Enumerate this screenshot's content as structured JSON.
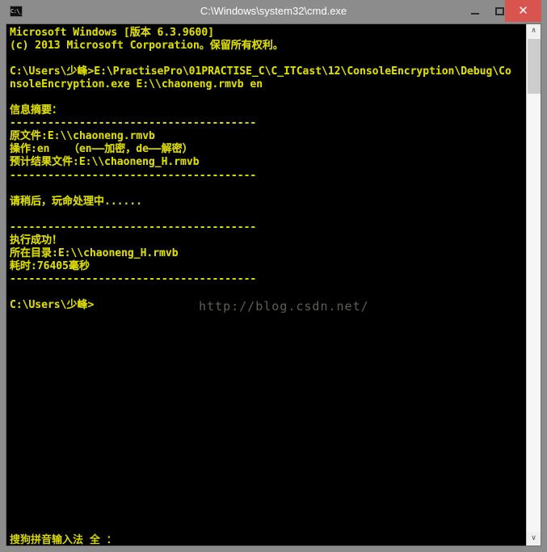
{
  "window": {
    "title": "C:\\Windows\\system32\\cmd.exe",
    "icon_label": "C:\\_",
    "titlebar_color": "#8c8c8c",
    "close_color": "#d9534f",
    "controls": {
      "minimize": "–",
      "maximize": "□",
      "close": "✕"
    }
  },
  "console": {
    "background": "#000000",
    "foreground": "#d8d800",
    "lines": [
      "Microsoft Windows [版本 6.3.9600]",
      "(c) 2013 Microsoft Corporation。保留所有权利。",
      "",
      "C:\\Users\\少峰>E:\\PractisePro\\01PRACTISE_C\\C_ITCast\\12\\ConsoleEncryption\\Debug\\Co",
      "nsoleEncryption.exe E:\\\\chaoneng.rmvb en",
      "",
      "信息摘要：",
      "---------------------------------------",
      "原文件:E:\\\\chaoneng.rmvb",
      "操作:en   （en——加密，de——解密）",
      "预计结果文件:E:\\\\chaoneng_H.rmvb",
      "---------------------------------------",
      "",
      "请稍后，玩命处理中......",
      "",
      "---------------------------------------",
      "执行成功！",
      "所在目录:E:\\\\chaoneng_H.rmvb",
      "耗时:76405毫秒",
      "---------------------------------------",
      "",
      "C:\\Users\\少峰>"
    ]
  },
  "watermark": {
    "text": "http://blog.csdn.net/",
    "color": "#7a7a6e"
  },
  "ime": {
    "text": "搜狗拼音输入法 全 ："
  },
  "scrollbar": {
    "up_arrow": "∧",
    "down_arrow": "∨",
    "thumb_color": "#cdcdcd",
    "track_color": "#f6f6f6"
  }
}
